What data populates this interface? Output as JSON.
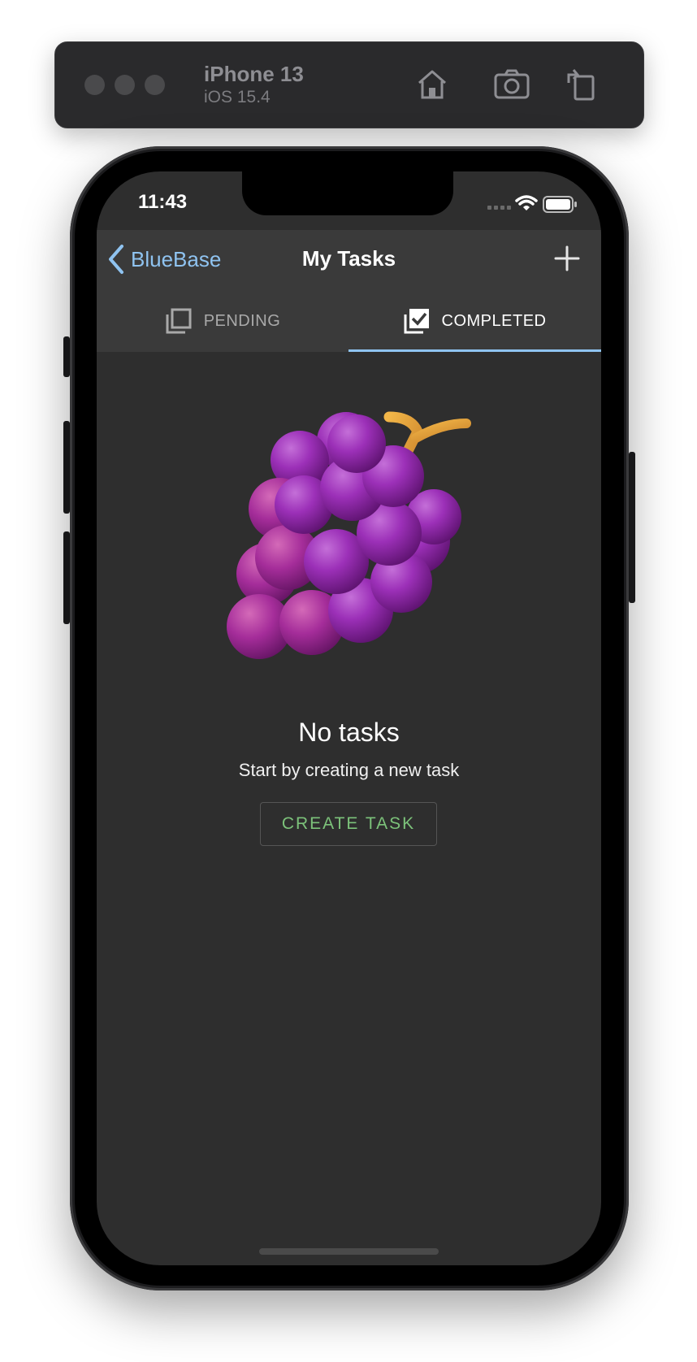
{
  "simulator": {
    "device_name": "iPhone 13",
    "os_version": "iOS 15.4",
    "icons": [
      "home-icon",
      "screenshot-icon",
      "rotate-icon"
    ]
  },
  "status_bar": {
    "time": "11:43",
    "icons": [
      "signal-icon",
      "wifi-icon",
      "battery-icon"
    ]
  },
  "navbar": {
    "back_label": "BlueBase",
    "title": "My Tasks",
    "add_icon": "plus-icon"
  },
  "tabs": [
    {
      "label": "PENDING",
      "icon": "checkbox-outline-icon",
      "active": false
    },
    {
      "label": "COMPLETED",
      "icon": "checkbox-checked-icon",
      "active": true
    }
  ],
  "empty_state": {
    "image": "grapes-icon",
    "title": "No tasks",
    "subtitle": "Start by creating a new task",
    "button_label": "CREATE TASK"
  },
  "colors": {
    "accent": "#8fc3f0",
    "button_text": "#7cc27a",
    "screen_bg": "#2e2e2e",
    "header_bg": "#3a3a3a"
  }
}
